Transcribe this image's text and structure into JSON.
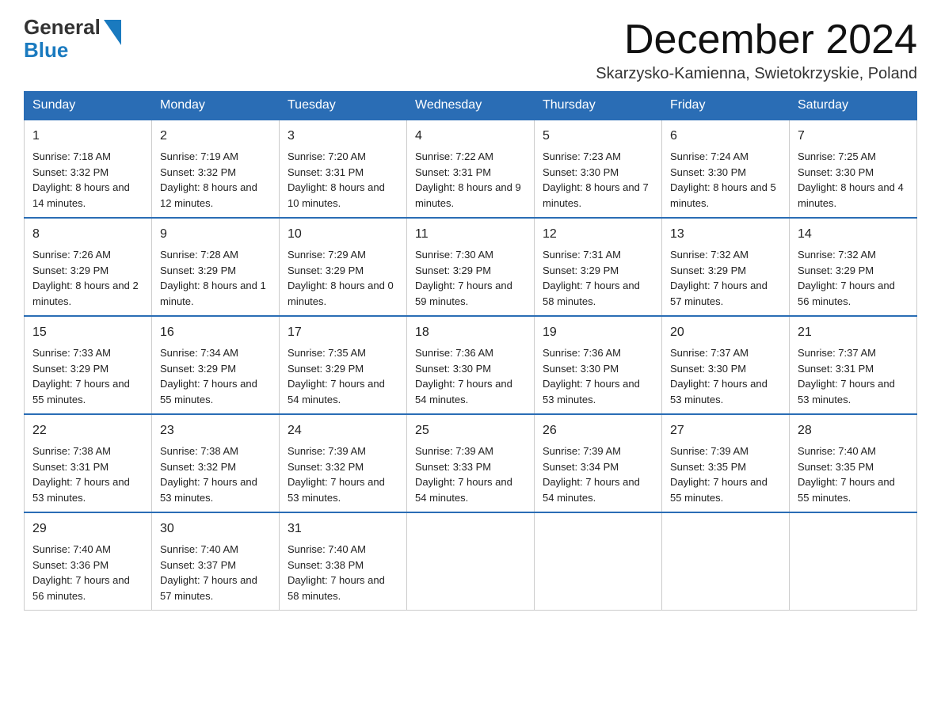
{
  "header": {
    "logo": {
      "general": "General",
      "blue": "Blue"
    },
    "title": "December 2024",
    "subtitle": "Skarzysko-Kamienna, Swietokrzyskie, Poland"
  },
  "calendar": {
    "days": [
      "Sunday",
      "Monday",
      "Tuesday",
      "Wednesday",
      "Thursday",
      "Friday",
      "Saturday"
    ],
    "weeks": [
      [
        {
          "num": "1",
          "sunrise": "7:18 AM",
          "sunset": "3:32 PM",
          "daylight": "8 hours and 14 minutes."
        },
        {
          "num": "2",
          "sunrise": "7:19 AM",
          "sunset": "3:32 PM",
          "daylight": "8 hours and 12 minutes."
        },
        {
          "num": "3",
          "sunrise": "7:20 AM",
          "sunset": "3:31 PM",
          "daylight": "8 hours and 10 minutes."
        },
        {
          "num": "4",
          "sunrise": "7:22 AM",
          "sunset": "3:31 PM",
          "daylight": "8 hours and 9 minutes."
        },
        {
          "num": "5",
          "sunrise": "7:23 AM",
          "sunset": "3:30 PM",
          "daylight": "8 hours and 7 minutes."
        },
        {
          "num": "6",
          "sunrise": "7:24 AM",
          "sunset": "3:30 PM",
          "daylight": "8 hours and 5 minutes."
        },
        {
          "num": "7",
          "sunrise": "7:25 AM",
          "sunset": "3:30 PM",
          "daylight": "8 hours and 4 minutes."
        }
      ],
      [
        {
          "num": "8",
          "sunrise": "7:26 AM",
          "sunset": "3:29 PM",
          "daylight": "8 hours and 2 minutes."
        },
        {
          "num": "9",
          "sunrise": "7:28 AM",
          "sunset": "3:29 PM",
          "daylight": "8 hours and 1 minute."
        },
        {
          "num": "10",
          "sunrise": "7:29 AM",
          "sunset": "3:29 PM",
          "daylight": "8 hours and 0 minutes."
        },
        {
          "num": "11",
          "sunrise": "7:30 AM",
          "sunset": "3:29 PM",
          "daylight": "7 hours and 59 minutes."
        },
        {
          "num": "12",
          "sunrise": "7:31 AM",
          "sunset": "3:29 PM",
          "daylight": "7 hours and 58 minutes."
        },
        {
          "num": "13",
          "sunrise": "7:32 AM",
          "sunset": "3:29 PM",
          "daylight": "7 hours and 57 minutes."
        },
        {
          "num": "14",
          "sunrise": "7:32 AM",
          "sunset": "3:29 PM",
          "daylight": "7 hours and 56 minutes."
        }
      ],
      [
        {
          "num": "15",
          "sunrise": "7:33 AM",
          "sunset": "3:29 PM",
          "daylight": "7 hours and 55 minutes."
        },
        {
          "num": "16",
          "sunrise": "7:34 AM",
          "sunset": "3:29 PM",
          "daylight": "7 hours and 55 minutes."
        },
        {
          "num": "17",
          "sunrise": "7:35 AM",
          "sunset": "3:29 PM",
          "daylight": "7 hours and 54 minutes."
        },
        {
          "num": "18",
          "sunrise": "7:36 AM",
          "sunset": "3:30 PM",
          "daylight": "7 hours and 54 minutes."
        },
        {
          "num": "19",
          "sunrise": "7:36 AM",
          "sunset": "3:30 PM",
          "daylight": "7 hours and 53 minutes."
        },
        {
          "num": "20",
          "sunrise": "7:37 AM",
          "sunset": "3:30 PM",
          "daylight": "7 hours and 53 minutes."
        },
        {
          "num": "21",
          "sunrise": "7:37 AM",
          "sunset": "3:31 PM",
          "daylight": "7 hours and 53 minutes."
        }
      ],
      [
        {
          "num": "22",
          "sunrise": "7:38 AM",
          "sunset": "3:31 PM",
          "daylight": "7 hours and 53 minutes."
        },
        {
          "num": "23",
          "sunrise": "7:38 AM",
          "sunset": "3:32 PM",
          "daylight": "7 hours and 53 minutes."
        },
        {
          "num": "24",
          "sunrise": "7:39 AM",
          "sunset": "3:32 PM",
          "daylight": "7 hours and 53 minutes."
        },
        {
          "num": "25",
          "sunrise": "7:39 AM",
          "sunset": "3:33 PM",
          "daylight": "7 hours and 54 minutes."
        },
        {
          "num": "26",
          "sunrise": "7:39 AM",
          "sunset": "3:34 PM",
          "daylight": "7 hours and 54 minutes."
        },
        {
          "num": "27",
          "sunrise": "7:39 AM",
          "sunset": "3:35 PM",
          "daylight": "7 hours and 55 minutes."
        },
        {
          "num": "28",
          "sunrise": "7:40 AM",
          "sunset": "3:35 PM",
          "daylight": "7 hours and 55 minutes."
        }
      ],
      [
        {
          "num": "29",
          "sunrise": "7:40 AM",
          "sunset": "3:36 PM",
          "daylight": "7 hours and 56 minutes."
        },
        {
          "num": "30",
          "sunrise": "7:40 AM",
          "sunset": "3:37 PM",
          "daylight": "7 hours and 57 minutes."
        },
        {
          "num": "31",
          "sunrise": "7:40 AM",
          "sunset": "3:38 PM",
          "daylight": "7 hours and 58 minutes."
        },
        null,
        null,
        null,
        null
      ]
    ]
  }
}
